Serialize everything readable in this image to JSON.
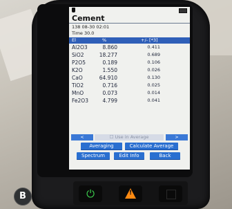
{
  "header": {
    "title": "Cement",
    "sample": "138  08-30 02:01",
    "time": "Time 30.0"
  },
  "table": {
    "columns": [
      "El",
      "%",
      "+/- [*3]"
    ],
    "rows": [
      {
        "el": "Al2O3",
        "pct": "8.860",
        "err": "0.411"
      },
      {
        "el": "SiO2",
        "pct": "18.277",
        "err": "0.689"
      },
      {
        "el": "P2O5",
        "pct": "0.189",
        "err": "0.106"
      },
      {
        "el": "K2O",
        "pct": "1.550",
        "err": "0.026"
      },
      {
        "el": "CaO",
        "pct": "64.910",
        "err": "0.130"
      },
      {
        "el": "TiO2",
        "pct": "0.716",
        "err": "0.025"
      },
      {
        "el": "MnO",
        "pct": "0.073",
        "err": "0.014"
      },
      {
        "el": "Fe2O3",
        "pct": "4.799",
        "err": "0.041"
      }
    ]
  },
  "nav": {
    "prev": "<",
    "use_in_average": "☐ Use in Average",
    "next": ">"
  },
  "buttons": {
    "averaging": "Averaging",
    "calculate_average": "Calculate Average",
    "spectrum": "Spectrum",
    "edit_info": "Edit Info",
    "back": "Back"
  },
  "hardware": {
    "power": "⏻",
    "warning": "!"
  },
  "photo_label": "B"
}
